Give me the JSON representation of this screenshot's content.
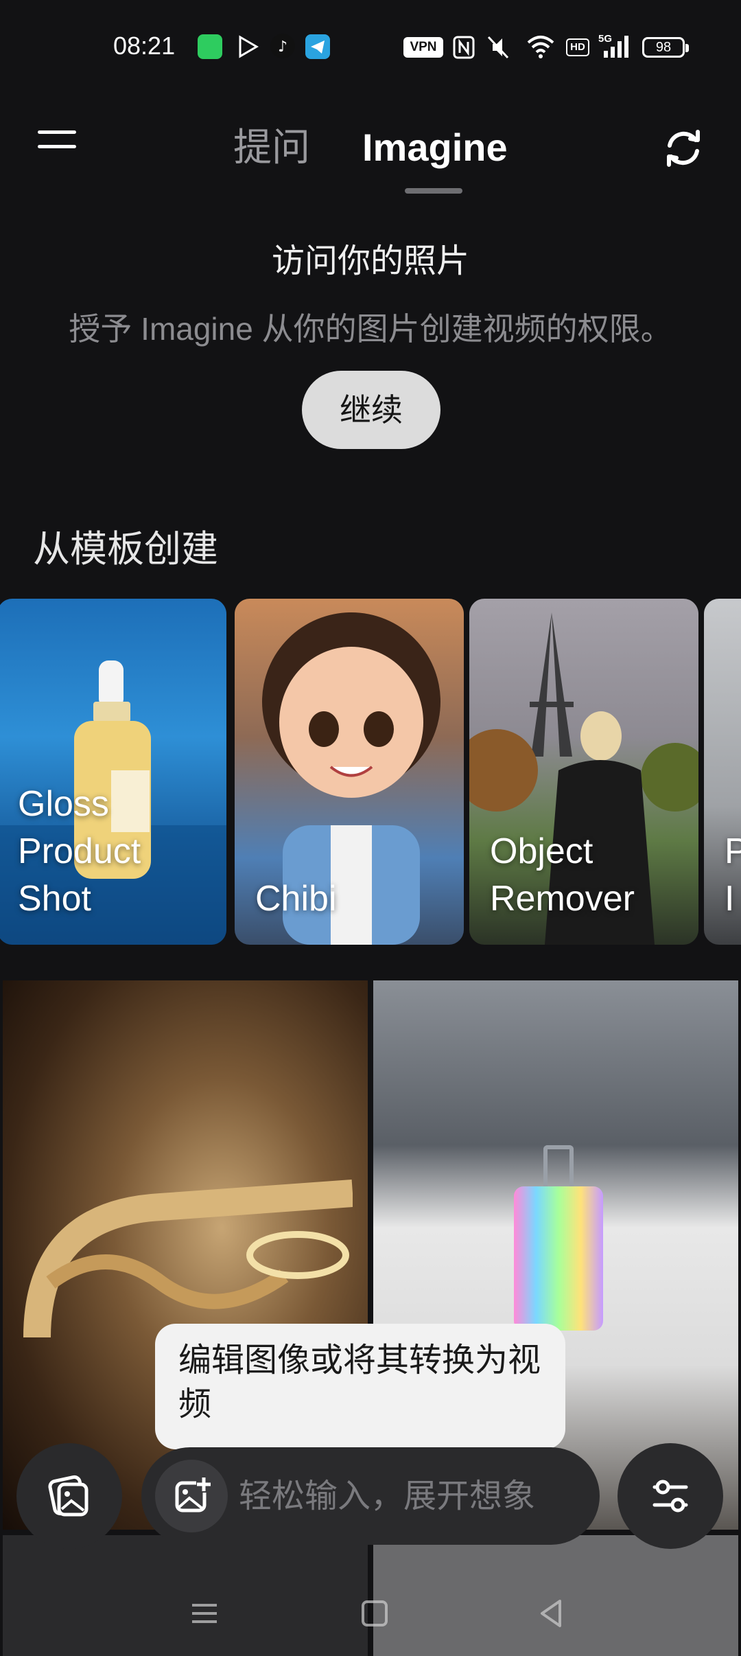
{
  "status_bar": {
    "time": "08:21",
    "vpn": "VPN",
    "network": "5G",
    "hd": "HD",
    "battery": "98",
    "app_icons": [
      "messages-icon",
      "play-store-icon",
      "tiktok-icon",
      "telegram-icon"
    ]
  },
  "header": {
    "tabs": [
      {
        "label": "提问",
        "active": false
      },
      {
        "label": "Imagine",
        "active": true
      }
    ],
    "menu_icon": "hamburger-icon",
    "refresh_icon": "refresh-icon"
  },
  "permission": {
    "title": "访问你的照片",
    "description": "授予 Imagine 从你的图片创建视频的权限。",
    "button_label": "继续"
  },
  "templates": {
    "section_title": "从模板创建",
    "items": [
      {
        "label": "Gloss\nProduct\nShot"
      },
      {
        "label": "Chibi"
      },
      {
        "label": "Object\nRemover"
      },
      {
        "label": "P\nI"
      }
    ]
  },
  "tooltip": {
    "text": "编辑图像或将其转换为视频"
  },
  "input_bar": {
    "placeholder": "轻松输入，展开想象",
    "value": ""
  },
  "colors": {
    "background": "#121214",
    "surface": "#2a2a2c",
    "tooltip_bg": "#f2f2f2",
    "button_bg": "#dcdcdc",
    "muted_text": "#8c8c90"
  }
}
